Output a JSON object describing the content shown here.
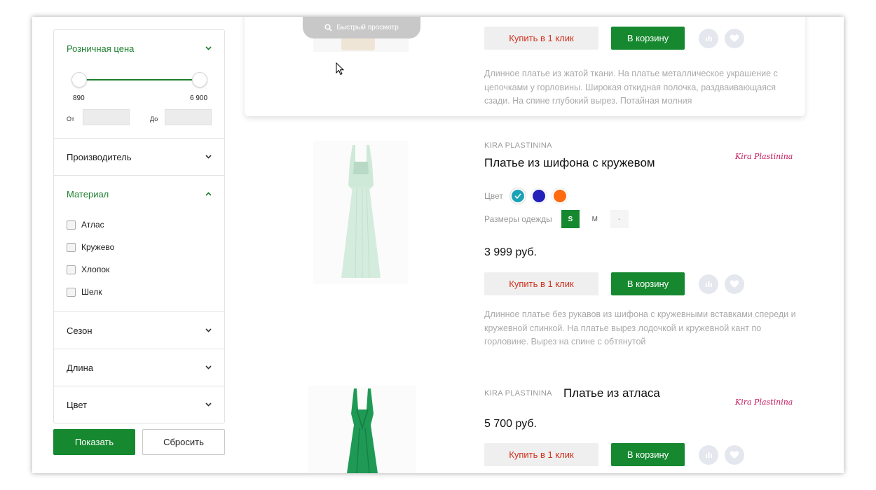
{
  "filters": {
    "price": {
      "title": "Розничная цена",
      "min": "890",
      "max": "6 900",
      "from_label": "От",
      "to_label": "До"
    },
    "maker": {
      "title": "Производитель"
    },
    "material": {
      "title": "Материал",
      "options": [
        "Атлас",
        "Кружево",
        "Хлопок",
        "Шелк"
      ]
    },
    "season": {
      "title": "Сезон"
    },
    "length": {
      "title": "Длина"
    },
    "color": {
      "title": "Цвет"
    },
    "show_label": "Показать",
    "reset_label": "Сбросить"
  },
  "quick_view": "Быстрый просмотр",
  "actions": {
    "buy_one_click": "Купить в 1 клик",
    "add_to_cart": "В корзину"
  },
  "products": [
    {
      "description": "Длинное платье из жатой ткани. На платье металлическое украшение с цепочками у горловины. Широкая откидная полочка, раздваивающаяся сзади. На спине глубокий вырез. Потайная молния"
    },
    {
      "brand": "KIRA PLASTININA",
      "name": "Платье из шифона с кружевом",
      "color_label": "Цвет",
      "size_label": "Размеры одежды",
      "sizes": [
        "S",
        "M",
        "-"
      ],
      "price": "3 999 руб.",
      "logo_text": "Kira Plastinina",
      "description": "Длинное платье без рукавов из шифона с кружевными вставками спереди и кружевной спинкой. На платье вырез лодочкой и кружевной кант по горловине. Вырез на спине с обтянутой"
    },
    {
      "brand": "KIRA PLASTININA",
      "name": "Платье из атласа",
      "price": "5 700 руб.",
      "logo_text": "Kira Plastinina"
    }
  ],
  "colors": {
    "accent": "#16882f",
    "swatches": [
      "#1aa3b5",
      "#2222bb",
      "#ff6a10"
    ]
  },
  "icons": [
    "search-icon",
    "chevron-down-icon",
    "chevron-up-icon",
    "compare-icon",
    "heart-icon",
    "check-icon",
    "cursor-icon"
  ]
}
